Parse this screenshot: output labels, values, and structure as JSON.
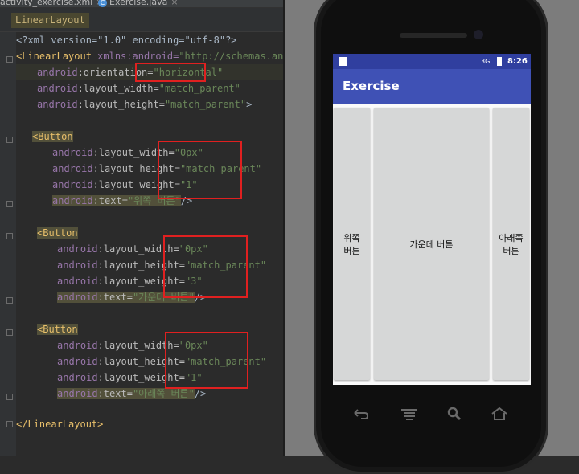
{
  "ide": {
    "tabs": [
      {
        "label": "activity_exercise.xml",
        "close": "×"
      },
      {
        "icon": "C",
        "label": "Exercise.java",
        "close": "×"
      }
    ],
    "breadcrumb": "LinearLayout",
    "code": {
      "l1": {
        "text": "<?xml version=\"1.0\" encoding=\"utf-8\"?>"
      },
      "l2": {
        "tag": "<LinearLayout",
        "ns": "xmlns:android=",
        "val": "\"http://schemas.android."
      },
      "l3": {
        "ns": "android",
        "attr": ":orientation=",
        "val": "\"horizontal\""
      },
      "l4": {
        "ns": "android",
        "attr": ":layout_width=",
        "val": "\"match_parent\""
      },
      "l5": {
        "ns": "android",
        "attr": ":layout_height=",
        "val": "\"match_parent\"",
        "end": ">"
      },
      "b1": {
        "tag": "<Button",
        "w": {
          "ns": "android",
          "attr": ":layout_width=",
          "val": "\"0px\""
        },
        "h": {
          "ns": "android",
          "attr": ":layout_height=",
          "val": "\"match_parent\""
        },
        "wt": {
          "ns": "android",
          "attr": ":layout_weight=",
          "val": "\"1\""
        },
        "t": {
          "ns": "android",
          "attr": ":text=",
          "val": "\"위쪽 버튼\"",
          "end": "/>"
        }
      },
      "b2": {
        "tag": "<Button",
        "w": {
          "ns": "android",
          "attr": ":layout_width=",
          "val": "\"0px\""
        },
        "h": {
          "ns": "android",
          "attr": ":layout_height=",
          "val": "\"match_parent\""
        },
        "wt": {
          "ns": "android",
          "attr": ":layout_weight=",
          "val": "\"3\""
        },
        "t": {
          "ns": "android",
          "attr": ":text=",
          "val": "\"가운데 버튼\"",
          "end": "/>"
        }
      },
      "b3": {
        "tag": "<Button",
        "w": {
          "ns": "android",
          "attr": ":layout_width=",
          "val": "\"0px\""
        },
        "h": {
          "ns": "android",
          "attr": ":layout_height=",
          "val": "\"match_parent\""
        },
        "wt": {
          "ns": "android",
          "attr": ":layout_weight=",
          "val": "\"1\""
        },
        "t": {
          "ns": "android",
          "attr": ":text=",
          "val": "\"아래쪽 버튼\"",
          "end": "/>"
        }
      },
      "close": "</LinearLayout>"
    }
  },
  "phone": {
    "status": {
      "signal": "3G",
      "time": "8:26"
    },
    "app_title": "Exercise",
    "buttons": {
      "top": [
        "위쪽",
        "버튼"
      ],
      "middle": "가운데 버튼",
      "bottom": [
        "아래쪽",
        "버튼"
      ]
    }
  },
  "colors": {
    "appbar": "#3f51b5",
    "statusbar": "#303f9f",
    "highlight_box": "#e02020"
  }
}
